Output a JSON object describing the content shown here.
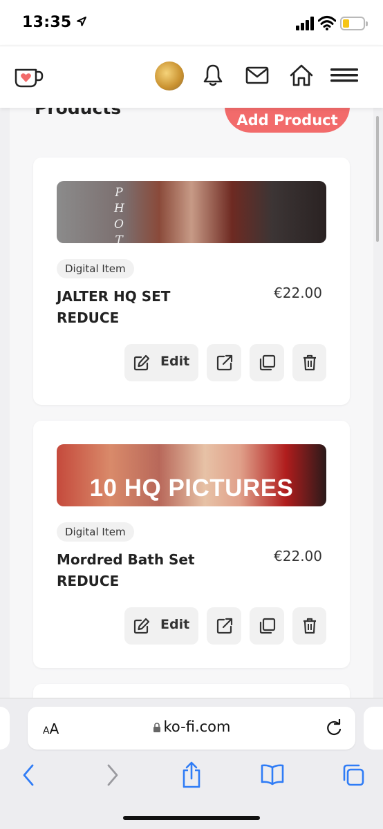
{
  "status": {
    "time": "13:35"
  },
  "header": {
    "logo_icon": "kofi-cup-icon",
    "icons": [
      "avatar",
      "bell-icon",
      "mail-icon",
      "home-icon",
      "menu-icon"
    ]
  },
  "main": {
    "title": "Products",
    "add_button": "Add Product",
    "products": [
      {
        "image_text": "PHOT",
        "tag": "Digital Item",
        "title_line1": "JALTER HQ SET",
        "title_line2": "REDUCE",
        "price": "€22.00",
        "edit_label": "Edit"
      },
      {
        "image_text": "10 HQ PICTURES",
        "tag": "Digital Item",
        "title_line1": "Mordred Bath Set",
        "title_line2": "REDUCE",
        "price": "€22.00",
        "edit_label": "Edit"
      }
    ]
  },
  "browser": {
    "text_size": "AA",
    "url": "ko-fi.com",
    "toolbar": [
      "back-icon",
      "forward-icon",
      "share-icon",
      "bookmarks-icon",
      "tabs-icon"
    ]
  },
  "colors": {
    "accent": "#f26b6b",
    "battery": "#f5c518",
    "safari_blue": "#2f7cf6"
  }
}
